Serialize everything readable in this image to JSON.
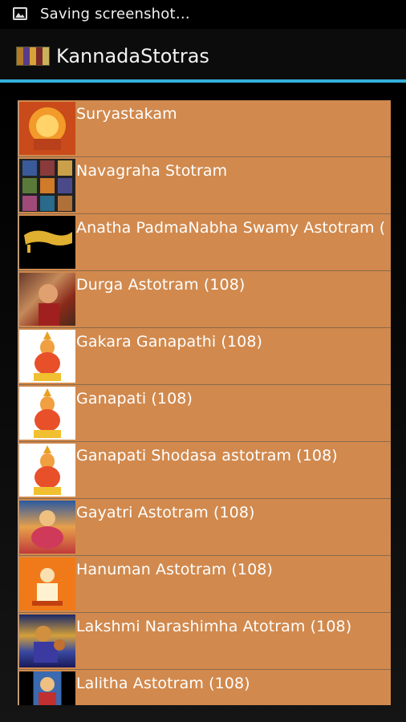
{
  "status_bar": {
    "notification_icon": "image-icon",
    "text": "Saving screenshot…"
  },
  "action_bar": {
    "app_icon": "app-logo",
    "title": "KannadaStotras"
  },
  "accent_color": "#34b0da",
  "list_bg_color": "#d1894d",
  "list": {
    "items": [
      {
        "label": "Suryastakam",
        "thumb": "surya-image"
      },
      {
        "label": "Navagraha Stotram",
        "thumb": "navagraha-image"
      },
      {
        "label": "Anatha PadmaNabha Swamy Astotram (",
        "thumb": "anatha-padmanabha-image"
      },
      {
        "label": "Durga Astotram (108)",
        "thumb": "durga-image"
      },
      {
        "label": "Gakara Ganapathi (108)",
        "thumb": "ganesha-image"
      },
      {
        "label": "Ganapati (108)",
        "thumb": "ganesha-image"
      },
      {
        "label": "Ganapati Shodasa astotram (108)",
        "thumb": "ganesha-image"
      },
      {
        "label": "Gayatri Astotram (108)",
        "thumb": "gayatri-image"
      },
      {
        "label": "Hanuman Astotram (108)",
        "thumb": "hanuman-image"
      },
      {
        "label": "Lakshmi Narashimha Atotram (108)",
        "thumb": "lakshmi-narasimha-image"
      },
      {
        "label": "Lalitha Astotram (108)",
        "thumb": "lalitha-image"
      }
    ]
  }
}
